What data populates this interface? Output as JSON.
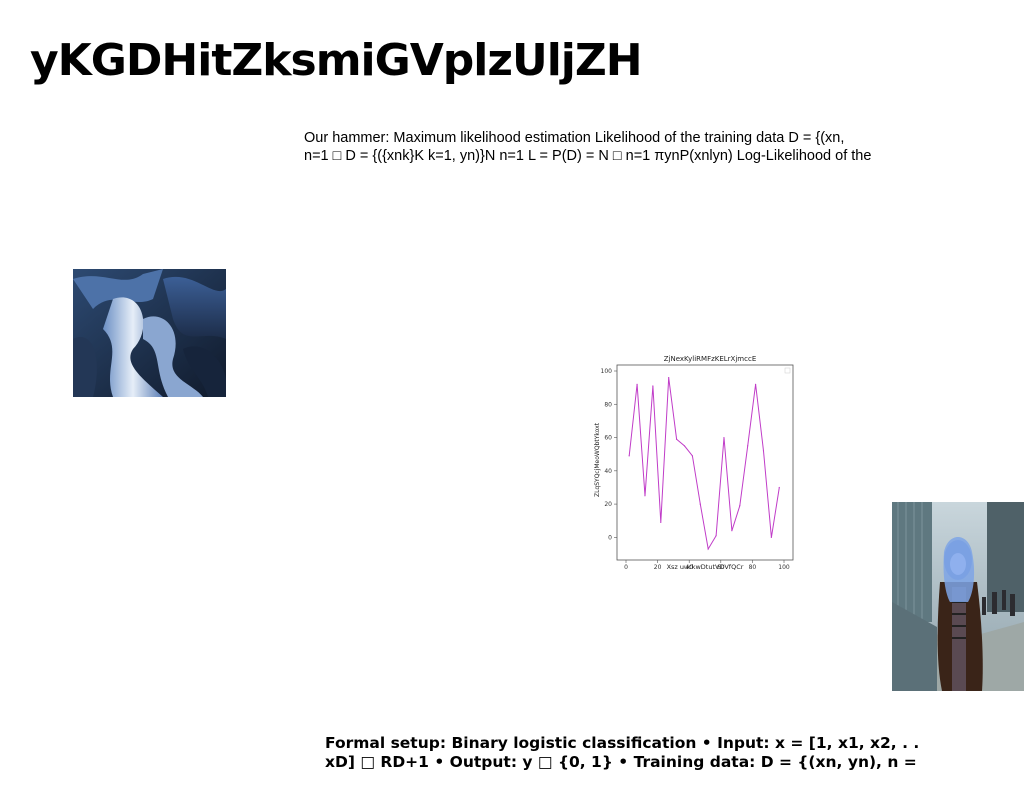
{
  "slide": {
    "title": "yKGDHitZksmiGVplzUljZH",
    "paragraph_lines": [
      "Our hammer: Maximum likelihood estimation Likelihood of the training data D = {(xn,",
      "n=1 □ D = {({xnk}K k=1, yn)}N n=1 L = P(D) = N □ n=1 πynP(xnlyn) Log-Likelihood of the"
    ],
    "bottom_lines": [
      "Formal setup: Binary logistic classification • Input: x = [1, x1, x2, . .",
      "xD] □ RD+1 • Output: y □ {0, 1} • Training data: D = {(xn, yn), n ="
    ]
  },
  "images": {
    "abstract": "abstract-blue-3d-shapes",
    "street": "person-with-blue-hair-on-street"
  },
  "chart_data": {
    "type": "line",
    "title": "ZjNexKyliRMFzKELrXjmccE",
    "xlabel": "Xsz uuckwDtutVDVfQCr",
    "ylabel": "ZLqSYQcjMeoWQbtYkoxt",
    "xlim": [
      0,
      100
    ],
    "ylim": [
      -10,
      100
    ],
    "x_ticks": [
      "0",
      "20",
      "40",
      "60",
      "80",
      "100"
    ],
    "y_ticks": [
      "0",
      "20",
      "40",
      "60",
      "80",
      "100"
    ],
    "color": "#c03cc8",
    "series": [
      {
        "x": [
          2,
          7,
          12,
          17,
          22,
          27,
          32,
          37,
          42,
          47,
          52,
          57,
          62,
          67,
          72,
          77,
          82,
          87,
          92,
          97
        ],
        "y": [
          49,
          92,
          25,
          91,
          9,
          96,
          59,
          55,
          49,
          20,
          -7,
          1,
          60,
          4,
          19,
          55,
          92,
          52,
          0,
          30
        ]
      }
    ]
  }
}
